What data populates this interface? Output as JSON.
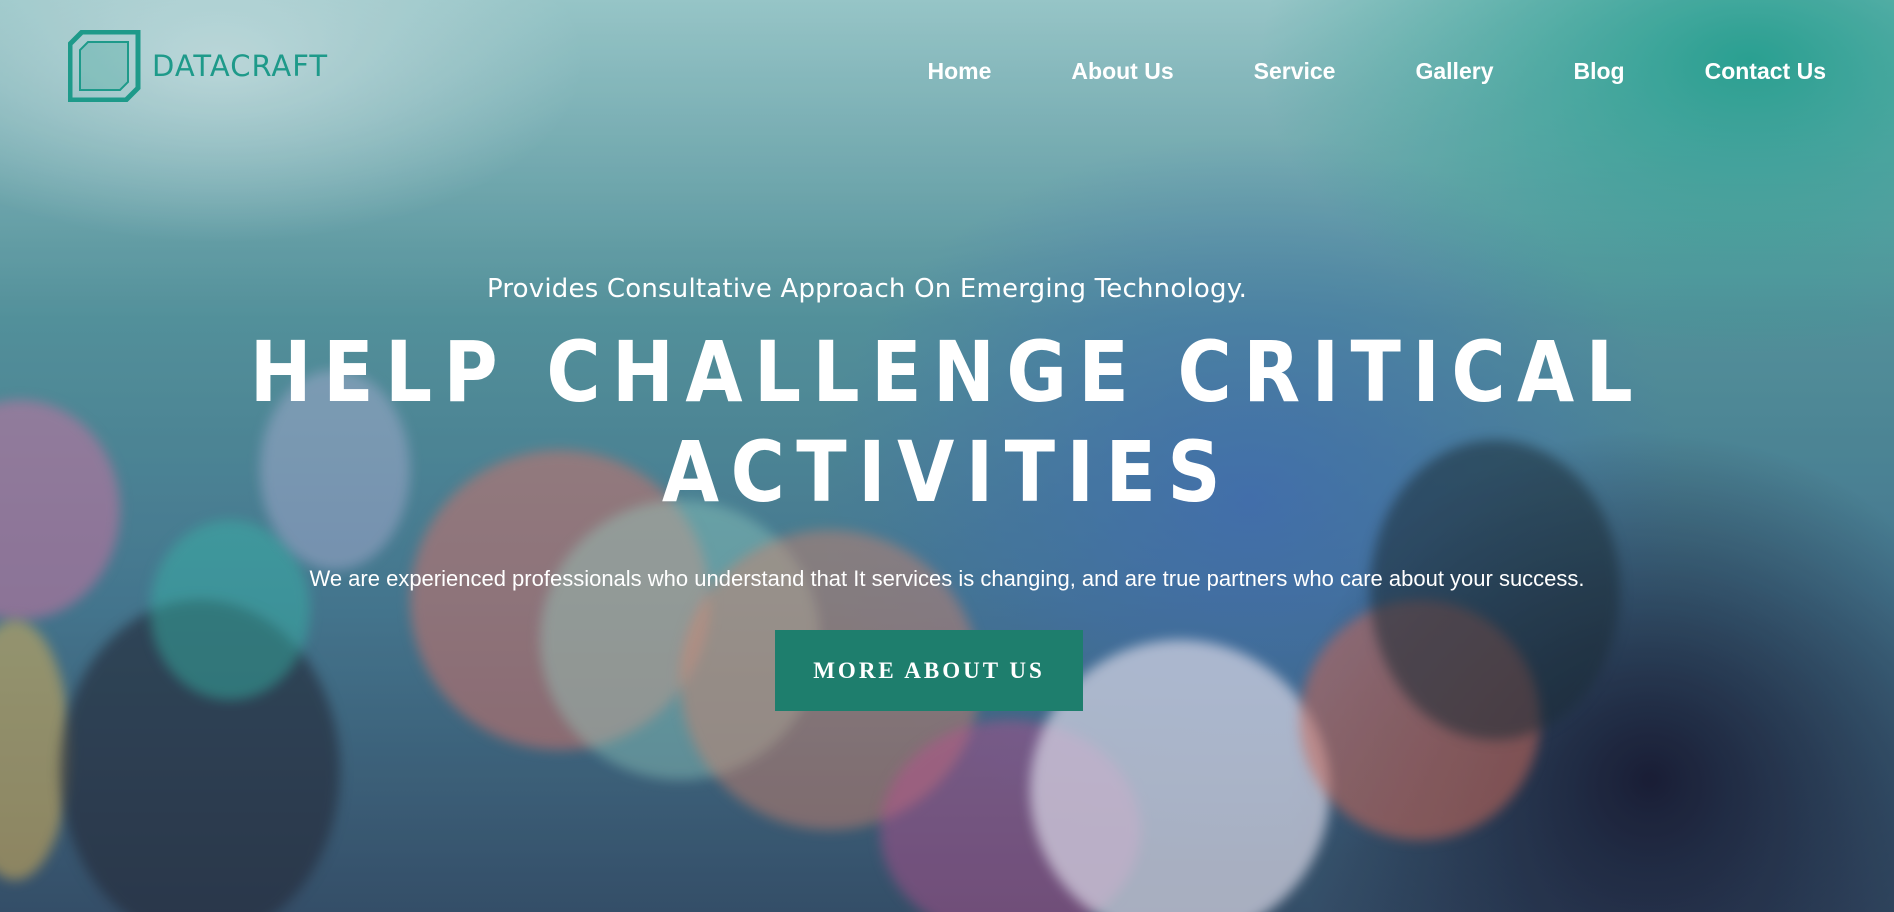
{
  "brand": {
    "name": "DATACRAFT",
    "logo_icon": "octagon-frame-icon",
    "color": "#1e9a8a"
  },
  "nav": {
    "items": [
      {
        "label": "Home"
      },
      {
        "label": "About Us"
      },
      {
        "label": "Service"
      },
      {
        "label": "Gallery"
      },
      {
        "label": "Blog"
      },
      {
        "label": "Contact Us"
      }
    ]
  },
  "hero": {
    "kicker": "Provides Consultative Approach On Emerging Technology.",
    "headline_line1": "HELP CHALLENGE CRITICAL",
    "headline_line2": "ACTIVITIES",
    "description": "We are experienced professionals who understand that It services is changing, and are true partners who care about your success.",
    "cta_label": "MORE ABOUT US",
    "cta_color": "#1e7e6d"
  }
}
